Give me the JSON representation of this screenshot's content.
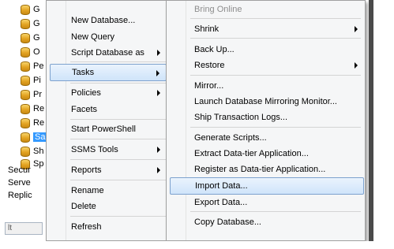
{
  "tree": {
    "db_items": [
      {
        "label": "G",
        "selected": false
      },
      {
        "label": "G",
        "selected": false
      },
      {
        "label": "G",
        "selected": false
      },
      {
        "label": "O",
        "selected": false
      },
      {
        "label": "Pe",
        "selected": false
      },
      {
        "label": "Pi",
        "selected": false
      },
      {
        "label": "Pr",
        "selected": false
      },
      {
        "label": "Re",
        "selected": false
      },
      {
        "label": "Re",
        "selected": false
      },
      {
        "label": "Sa",
        "selected": true
      },
      {
        "label": "Sh",
        "selected": false
      },
      {
        "label": "Sp",
        "selected": false
      }
    ],
    "folders": [
      {
        "label": "Secur"
      },
      {
        "label": "Serve"
      },
      {
        "label": "Replic"
      }
    ],
    "scroll_label": "lt"
  },
  "context_menu": {
    "items": [
      {
        "label": "New Database..."
      },
      {
        "label": "New Query"
      },
      {
        "label": "Script Database as"
      },
      {
        "label": "Tasks"
      },
      {
        "label": "Policies"
      },
      {
        "label": "Facets"
      },
      {
        "label": "Start PowerShell"
      },
      {
        "label": "SSMS Tools"
      },
      {
        "label": "Reports"
      },
      {
        "label": "Rename"
      },
      {
        "label": "Delete"
      },
      {
        "label": "Refresh"
      }
    ]
  },
  "tasks_menu": {
    "items": [
      {
        "label": "Bring Online"
      },
      {
        "label": "Shrink"
      },
      {
        "label": "Back Up..."
      },
      {
        "label": "Restore"
      },
      {
        "label": "Mirror..."
      },
      {
        "label": "Launch Database Mirroring Monitor..."
      },
      {
        "label": "Ship Transaction Logs..."
      },
      {
        "label": "Generate Scripts..."
      },
      {
        "label": "Extract Data-tier Application..."
      },
      {
        "label": "Register as Data-tier Application..."
      },
      {
        "label": "Import Data..."
      },
      {
        "label": "Export Data..."
      },
      {
        "label": "Copy Database..."
      }
    ]
  },
  "colors": {
    "highlight_border": "#7da2ce",
    "highlight_fill": "#cfe4fa",
    "selection_blue": "#3399ff"
  }
}
